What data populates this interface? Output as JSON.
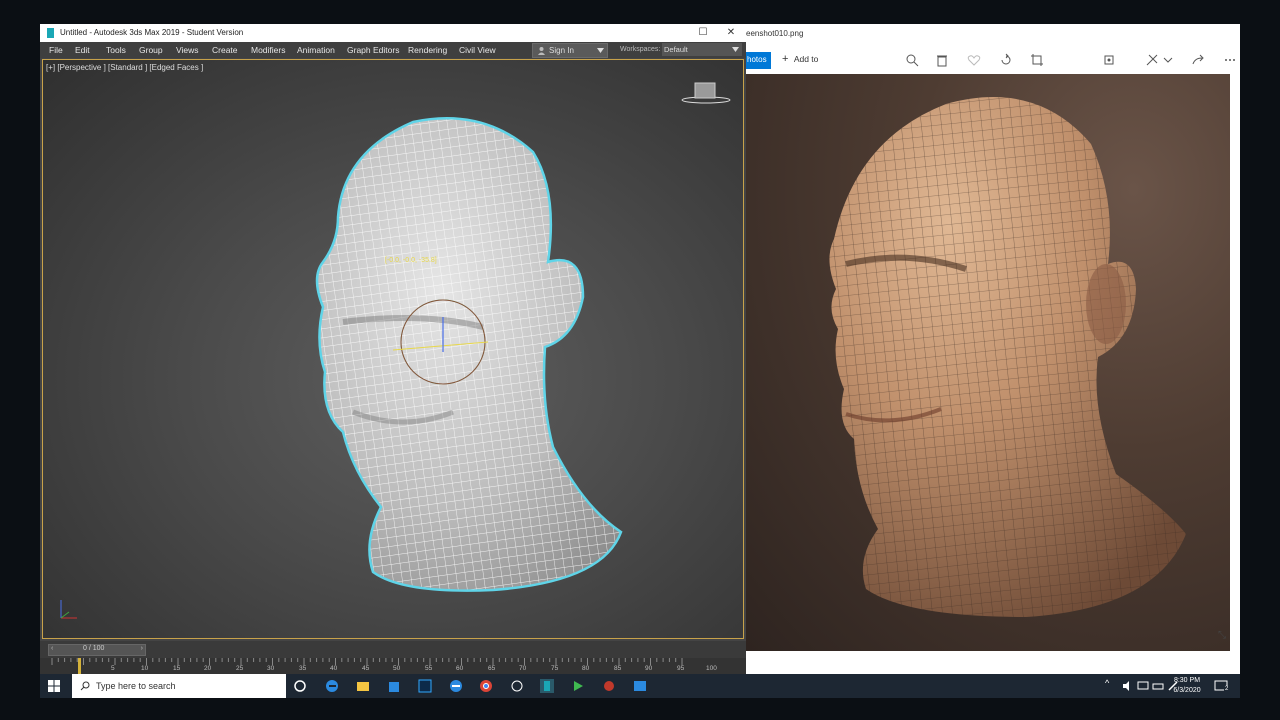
{
  "max": {
    "title": "Untitled - Autodesk 3ds Max 2019 - Student Version",
    "menu": [
      "File",
      "Edit",
      "Tools",
      "Group",
      "Views",
      "Create",
      "Modifiers",
      "Animation",
      "Graph Editors",
      "Rendering",
      "Civil View"
    ],
    "signin": "Sign In",
    "workspaces_label": "Workspaces:",
    "workspace_value": "Default",
    "viewport_label": "[+] [Perspective ] [Standard ] [Edged Faces ]",
    "coord_readout": "[-0.0, -0.0, -35.8]",
    "timeline_text": "0 / 100",
    "ruler_ticks": [
      "5",
      "10",
      "15",
      "20",
      "25",
      "30",
      "35",
      "40",
      "45",
      "50",
      "55",
      "60",
      "65",
      "70",
      "75",
      "80",
      "85",
      "90",
      "95",
      "100"
    ]
  },
  "photos": {
    "title": "eenshot010.png",
    "tab_label": "hotos",
    "add_to": "Add to"
  },
  "taskbar": {
    "search_placeholder": "Type here to search",
    "time": "8:30 PM",
    "date": "6/3/2020",
    "notification_count": "2"
  },
  "colors": {
    "accent_blue": "#0078d7",
    "wire_highlight": "#5fd4e8",
    "viewport_border": "#c8a24a"
  }
}
